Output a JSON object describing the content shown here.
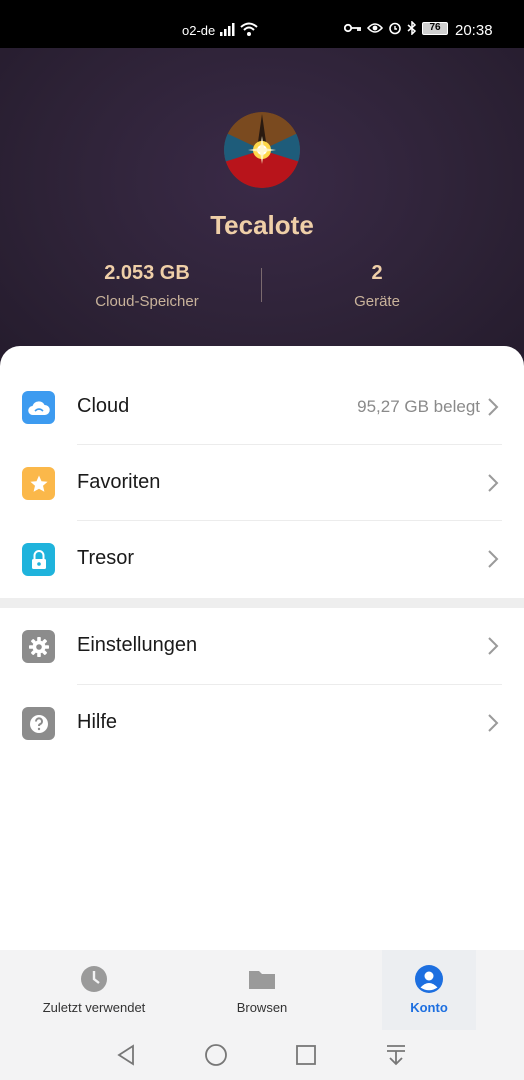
{
  "status_bar": {
    "carrier": "o2-de",
    "battery": "76",
    "time": "20:38",
    "icons": [
      "signal-icon",
      "wifi-icon",
      "key-icon",
      "eye-icon",
      "alarm-icon",
      "bluetooth-icon",
      "battery-icon"
    ]
  },
  "profile": {
    "name": "Tecalote",
    "storage_value": "2.053 GB",
    "storage_label": "Cloud-Speicher",
    "devices_value": "2",
    "devices_label": "Geräte"
  },
  "menu": {
    "items": [
      {
        "label": "Cloud",
        "value": "95,27 GB belegt",
        "icon": "cloud-icon",
        "color": "#3d9bf0"
      },
      {
        "label": "Favoriten",
        "value": "",
        "icon": "star-icon",
        "color": "#fbb84a"
      },
      {
        "label": "Tresor",
        "value": "",
        "icon": "lock-icon",
        "color": "#1fb3dc"
      },
      {
        "label": "Einstellungen",
        "value": "",
        "icon": "gear-icon",
        "color": "#8c8c8c"
      },
      {
        "label": "Hilfe",
        "value": "",
        "icon": "help-icon",
        "color": "#8c8c8c"
      }
    ]
  },
  "bottom_nav": {
    "items": [
      {
        "label": "Zuletzt verwendet",
        "icon": "clock-icon"
      },
      {
        "label": "Browsen",
        "icon": "folder-icon"
      },
      {
        "label": "Konto",
        "icon": "account-icon",
        "active": true
      }
    ],
    "active_color": "#1d6fe0"
  },
  "system_nav": [
    "back-icon",
    "home-icon",
    "recents-icon",
    "notification-pull-icon"
  ]
}
